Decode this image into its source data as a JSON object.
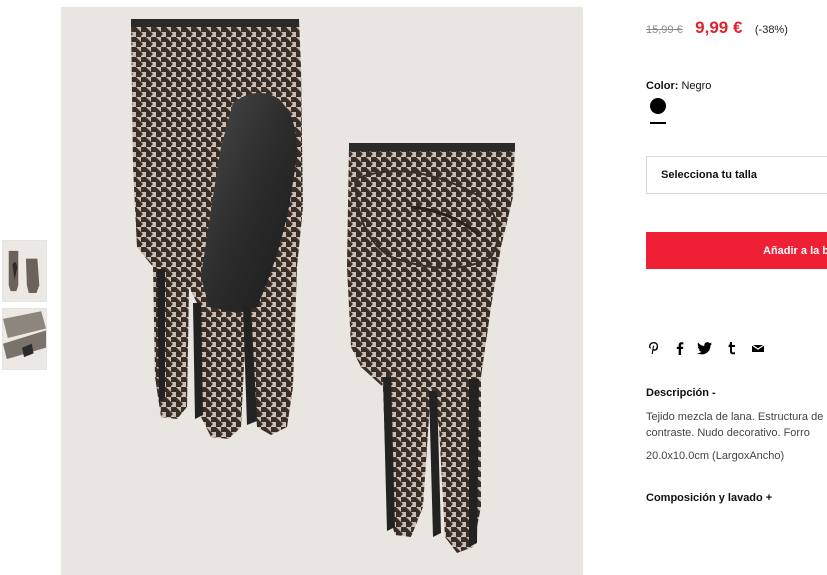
{
  "product": {
    "price_old": "15,99 €",
    "price_new": "9,99 €",
    "discount": "(-38%)",
    "color_label": "Color:",
    "color_value": "Negro",
    "size_placeholder": "Selecciona tu talla",
    "add_to_cart": "Añadir a la bolsa",
    "description_title": "Descripción -",
    "description_lines": [
      "Tejido mezcla de lana. Estructura de",
      "contraste. Nudo decorativo. Forro"
    ],
    "dimensions": "20.0x10.0cm (LargoxAncho)",
    "composition_title": "Composición y lavado +"
  },
  "share_icons": [
    "pinterest-icon",
    "facebook-icon",
    "twitter-icon",
    "tumblr-icon",
    "email-icon"
  ],
  "colors": {
    "price_accent": "#e3232b",
    "button_red": "#ef1f35",
    "swatch": "#000000"
  }
}
